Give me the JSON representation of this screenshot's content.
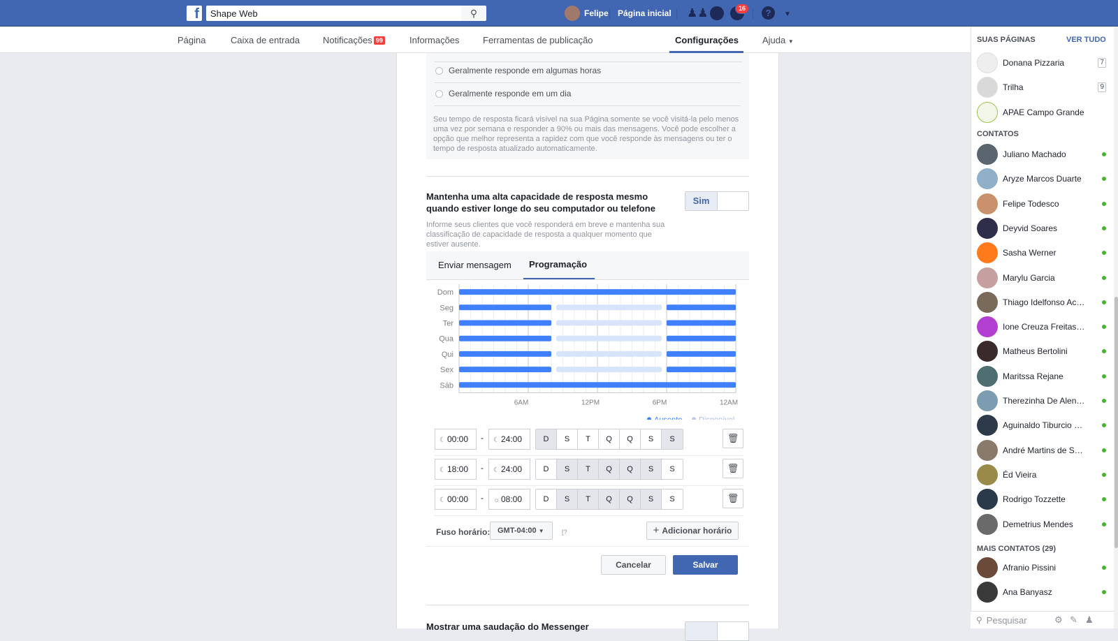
{
  "topbar": {
    "search_value": "Shape Web",
    "user_name": "Felipe",
    "home_label": "Página inicial",
    "notifications_count": "16"
  },
  "subnav": {
    "items": [
      "Página",
      "Caixa de entrada",
      "Notificações",
      "Informações",
      "Ferramentas de publicação",
      "Configurações",
      "Ajuda"
    ],
    "notifications_badge": "99",
    "active": "Configurações"
  },
  "response_time": {
    "options": [
      "Geralmente responde em algumas horas",
      "Geralmente responde em um dia"
    ],
    "note": "Seu tempo de resposta ficará visível na sua Página somente se você visitá-la pelo menos uma vez por semana e responder a 90% ou mais das mensagens. Você pode escolher a opção que melhor representa a rapidez com que você responde às mensagens ou ter o tempo de resposta atualizado automaticamente."
  },
  "away_section": {
    "title": "Mantenha uma alta capacidade de resposta mesmo quando estiver longe do seu computador ou telefone",
    "description": "Informe seus clientes que você responderá em breve e mantenha sua classificação de capacidade de resposta a qualquer momento que estiver ausente.",
    "toggle_label": "Sim",
    "tabs": [
      "Enviar mensagem",
      "Programação"
    ],
    "active_tab": "Programação"
  },
  "chart_data": {
    "type": "gantt",
    "days": [
      "Dom",
      "Seg",
      "Ter",
      "Qua",
      "Qui",
      "Sex",
      "Sáb"
    ],
    "x_ticks": [
      "6AM",
      "12PM",
      "6PM",
      "12AM"
    ],
    "x_range_hours": [
      0,
      24
    ],
    "legend": [
      "Ausente",
      "Disponível"
    ],
    "colors": {
      "away": "#4080ff",
      "available": "#d8e4fa"
    },
    "series": [
      {
        "day": "Dom",
        "away": [
          [
            0,
            24
          ]
        ],
        "available": []
      },
      {
        "day": "Seg",
        "away": [
          [
            0,
            8
          ],
          [
            18,
            24
          ]
        ],
        "available": [
          [
            8,
            18
          ]
        ]
      },
      {
        "day": "Ter",
        "away": [
          [
            0,
            8
          ],
          [
            18,
            24
          ]
        ],
        "available": [
          [
            8,
            18
          ]
        ]
      },
      {
        "day": "Qua",
        "away": [
          [
            0,
            8
          ],
          [
            18,
            24
          ]
        ],
        "available": [
          [
            8,
            18
          ]
        ]
      },
      {
        "day": "Qui",
        "away": [
          [
            0,
            8
          ],
          [
            18,
            24
          ]
        ],
        "available": [
          [
            8,
            18
          ]
        ]
      },
      {
        "day": "Sex",
        "away": [
          [
            0,
            8
          ],
          [
            18,
            24
          ]
        ],
        "available": [
          [
            8,
            18
          ]
        ]
      },
      {
        "day": "Sáb",
        "away": [
          [
            0,
            24
          ]
        ],
        "available": []
      }
    ]
  },
  "schedule_rows": [
    {
      "start": "00:00",
      "start_icon": "moon-icon",
      "end": "24:00",
      "end_icon": "moon-icon",
      "days": [
        "D",
        "S",
        "T",
        "Q",
        "Q",
        "S",
        "S"
      ],
      "selected": [
        true,
        false,
        false,
        false,
        false,
        false,
        true
      ]
    },
    {
      "start": "18:00",
      "start_icon": "moon-icon",
      "end": "24:00",
      "end_icon": "moon-icon",
      "days": [
        "D",
        "S",
        "T",
        "Q",
        "Q",
        "S",
        "S"
      ],
      "selected": [
        false,
        true,
        true,
        true,
        true,
        true,
        false
      ]
    },
    {
      "start": "00:00",
      "start_icon": "moon-icon",
      "end": "08:00",
      "end_icon": "sun-icon",
      "days": [
        "D",
        "S",
        "T",
        "Q",
        "Q",
        "S",
        "S"
      ],
      "selected": [
        false,
        true,
        true,
        true,
        true,
        true,
        false
      ]
    }
  ],
  "timezone": {
    "label": "Fuso horário:",
    "value": "GMT-04:00",
    "help": "[?"
  },
  "buttons": {
    "add_schedule": "Adicionar horário",
    "cancel": "Cancelar",
    "save": "Salvar"
  },
  "greeting_section": {
    "title": "Mostrar uma saudação do Messenger"
  },
  "sidebar": {
    "pages_header": "SUAS PÁGINAS",
    "see_all": "VER TUDO",
    "pages": [
      {
        "name": "Donana Pizzaria",
        "count": "7"
      },
      {
        "name": "Trilha",
        "count": "9"
      },
      {
        "name": "APAE Campo Grande",
        "count": ""
      }
    ],
    "contacts_header": "CONTATOS",
    "contacts": [
      "Juliano Machado",
      "Aryze Marcos Duarte",
      "Felipe Todesco",
      "Deyvid Soares",
      "Sasha Werner",
      "Marylu Garcia",
      "Thiago Idelfonso Aco…",
      "Ione Creuza Freitas …",
      "Matheus Bertolini",
      "Maritssa Rejane",
      "Therezinha De Alenc…",
      "Aguinaldo Tiburcio S…",
      "André Martins de San…",
      "Éd Vieira",
      "Rodrigo Tozzette",
      "Demetrius Mendes"
    ],
    "more_header": "MAIS CONTATOS (29)",
    "more_contacts": [
      "Afranio Pissini",
      "Ana Banyasz"
    ],
    "search_placeholder": "Pesquisar"
  }
}
